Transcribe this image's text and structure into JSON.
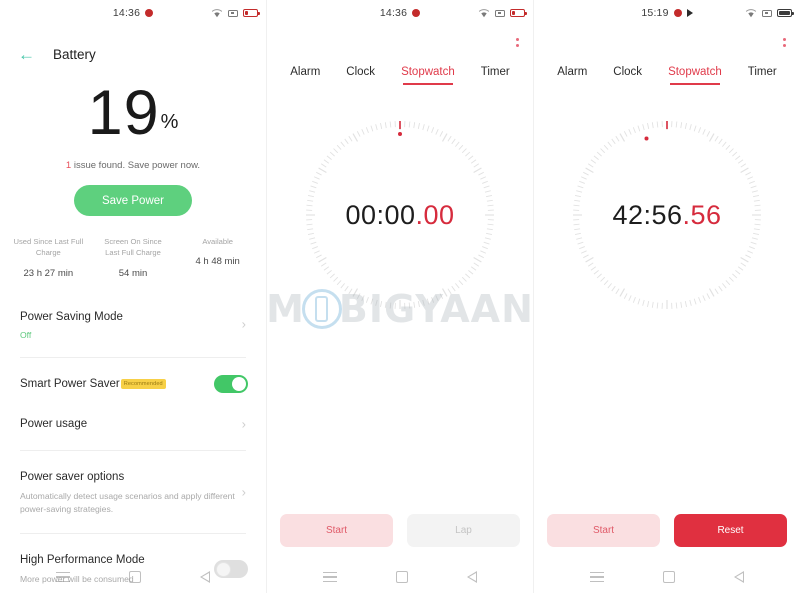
{
  "battery_screen": {
    "status_bar": {
      "time": "14:36",
      "icons": [
        "record-dot-icon",
        "wifi-icon",
        "screen-record-icon",
        "battery-low-icon"
      ]
    },
    "header": {
      "back_icon": "back-arrow-icon",
      "title": "Battery"
    },
    "percentage": "19",
    "percent_symbol": "%",
    "issue_count": "1",
    "issue_text": " issue found. Save power now.",
    "save_power_label": "Save Power",
    "stats": [
      {
        "label": "Used Since Last Full Charge",
        "value": "23 h 27 min"
      },
      {
        "label": "Screen On Since Last Full Charge",
        "value": "54 min"
      },
      {
        "label": "Available",
        "value": "4 h 48 min"
      }
    ],
    "rows": [
      {
        "title": "Power Saving Mode",
        "sub": "Off"
      },
      {
        "title": "Smart Power Saver",
        "badge": "Recommended",
        "toggle": "on"
      },
      {
        "title": "Power usage"
      },
      {
        "title": "Power saver options",
        "sub": "Automatically detect usage scenarios and apply different power-saving strategies."
      },
      {
        "title": "High Performance Mode",
        "sub": "More power will be consumed",
        "toggle": "off"
      }
    ]
  },
  "stopwatch_idle": {
    "status_bar": {
      "time": "14:36",
      "icons": [
        "record-dot-icon",
        "wifi-icon",
        "screen-record-icon",
        "battery-low-icon"
      ]
    },
    "kebab_icon": "more-options-icon",
    "tabs": [
      {
        "label": "Alarm",
        "active": false
      },
      {
        "label": "Clock",
        "active": false
      },
      {
        "label": "Stopwatch",
        "active": true
      },
      {
        "label": "Timer",
        "active": false
      }
    ],
    "time_main": "00:00",
    "time_ms": ".00",
    "buttons": [
      {
        "label": "Start",
        "style": "start"
      },
      {
        "label": "Lap",
        "style": "lap"
      }
    ]
  },
  "stopwatch_running": {
    "status_bar": {
      "time": "15:19",
      "icons": [
        "record-dot-icon",
        "play-icon",
        "wifi-icon",
        "screen-record-icon",
        "battery-full-icon"
      ]
    },
    "kebab_icon": "more-options-icon",
    "tabs": [
      {
        "label": "Alarm",
        "active": false
      },
      {
        "label": "Clock",
        "active": false
      },
      {
        "label": "Stopwatch",
        "active": true
      },
      {
        "label": "Timer",
        "active": false
      }
    ],
    "time_main": "42:56",
    "time_ms": ".56",
    "buttons": [
      {
        "label": "Start",
        "style": "start"
      },
      {
        "label": "Reset",
        "style": "reset"
      }
    ]
  },
  "navigation_bar": {
    "recents_icon": "recents-menu-icon",
    "home_icon": "home-square-icon",
    "back_icon": "back-triangle-icon"
  },
  "watermark": {
    "text_left": "M",
    "text_right": "BIGYAAN",
    "logo_icon": "mobigyaan-phone-logo"
  },
  "colors": {
    "accent_red": "#e03a4a",
    "green": "#5ed07e",
    "teal": "#46c6a8",
    "badge_yellow": "#f7d047"
  }
}
